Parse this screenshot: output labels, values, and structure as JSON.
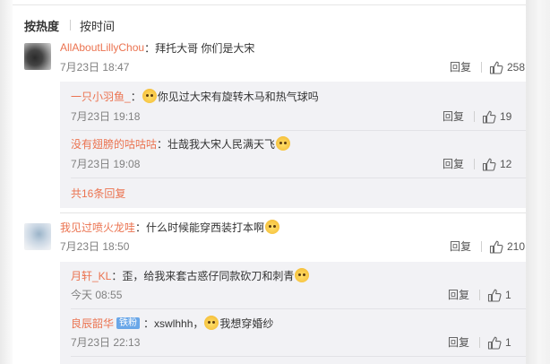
{
  "sort": {
    "hot": "按热度",
    "time": "按时间"
  },
  "labels": {
    "reply": "回复"
  },
  "comments": [
    {
      "user": "AllAboutLillyChou",
      "sep": "：",
      "text": "拜托大哥 你们是大宋",
      "time": "7月23日 18:47",
      "likes": "258",
      "replies": [
        {
          "user": "一只小羽鱼_",
          "sep": "：",
          "emoji": "doge-emoji",
          "text": "你见过大宋有旋转木马和热气球吗",
          "time": "7月23日 19:18",
          "likes": "19"
        },
        {
          "user": "没有翅膀的咕咕咕",
          "sep": "：",
          "text": "壮哉我大宋人民满天飞",
          "emoji": "doge-emoji",
          "time": "7月23日 19:08",
          "likes": "12"
        }
      ],
      "more_replies": "共16条回复"
    },
    {
      "user": "我见过喷火龙哇",
      "sep": "：",
      "text": "什么时候能穿西装打本啊",
      "emoji": "doge-emoji",
      "time": "7月23日 18:50",
      "likes": "210",
      "replies": [
        {
          "user": "月轩_KL",
          "sep": "：",
          "text": "歪，给我来套古惑仔同款砍刀和刺青",
          "emoji": "doge-emoji",
          "time": "今天 08:55",
          "likes": "1"
        },
        {
          "user": "良辰韶华",
          "badge": "铁粉",
          "sep": "：",
          "text": "xswlhhh，",
          "emoji": "doge-emoji",
          "text2": "我想穿婚纱",
          "time": "7月23日 22:13",
          "likes": "1"
        }
      ]
    }
  ],
  "colors": {
    "username": "#eb7350",
    "reply_bg": "#f2f2f5",
    "meta": "#808080"
  },
  "icons": {
    "like": "thumbs-up-icon",
    "emoji": "doge-emoji"
  }
}
